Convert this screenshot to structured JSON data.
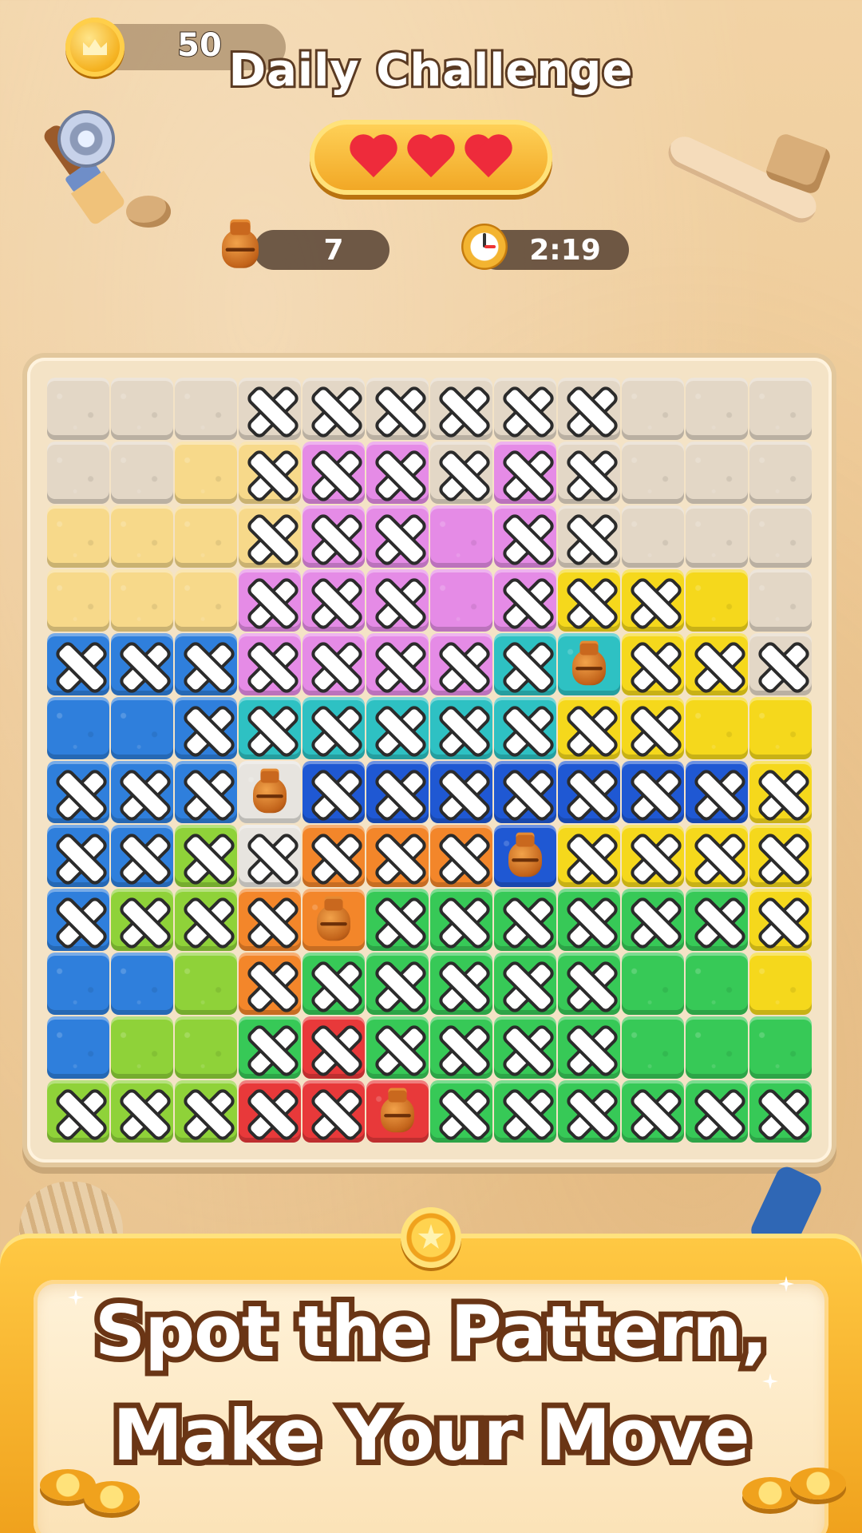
{
  "hud": {
    "coins": "50",
    "title": "Daily Challenge",
    "lives": 3,
    "jars_remaining": "7",
    "timer": "2:19"
  },
  "icons": {
    "coin": "crown-coin-icon",
    "settings": "gear-icon",
    "heart": "heart-icon",
    "jar": "jar-icon",
    "timer": "stopwatch-icon"
  },
  "colors": {
    "S": "#e3d7c6",
    "Y": "#f7d98a",
    "M": "#e58be6",
    "U": "#2f7fdc",
    "T": "#2ec1c3",
    "N": "#1f58d3",
    "G": "#f5d81c",
    "O": "#f3862a",
    "L": "#37c957",
    "K": "#8fd239",
    "R": "#e8393a",
    "W": "#e7e4df"
  },
  "board": {
    "rows": [
      [
        "S",
        "S",
        "S",
        "S",
        "S",
        "S",
        "S",
        "S",
        "S",
        "S",
        "S",
        "S"
      ],
      [
        "S",
        "S",
        "Y",
        "Y",
        "M",
        "M",
        "S",
        "M",
        "S",
        "S",
        "S",
        "S"
      ],
      [
        "Y",
        "Y",
        "Y",
        "Y",
        "M",
        "M",
        "M",
        "M",
        "S",
        "S",
        "S",
        "S"
      ],
      [
        "Y",
        "Y",
        "Y",
        "M",
        "M",
        "M",
        "M",
        "M",
        "G",
        "G",
        "G",
        "S"
      ],
      [
        "U",
        "U",
        "U",
        "M",
        "M",
        "M",
        "M",
        "T",
        "T",
        "G",
        "G",
        "S"
      ],
      [
        "U",
        "U",
        "U",
        "T",
        "T",
        "T",
        "T",
        "T",
        "G",
        "G",
        "G",
        "G"
      ],
      [
        "U",
        "U",
        "U",
        "W",
        "N",
        "N",
        "N",
        "N",
        "N",
        "N",
        "N",
        "G"
      ],
      [
        "U",
        "U",
        "K",
        "W",
        "O",
        "O",
        "O",
        "N",
        "G",
        "G",
        "G",
        "G"
      ],
      [
        "U",
        "K",
        "K",
        "O",
        "O",
        "L",
        "L",
        "L",
        "L",
        "L",
        "L",
        "G"
      ],
      [
        "U",
        "U",
        "K",
        "O",
        "L",
        "L",
        "L",
        "L",
        "L",
        "L",
        "L",
        "G"
      ],
      [
        "U",
        "K",
        "K",
        "L",
        "R",
        "L",
        "L",
        "L",
        "L",
        "L",
        "L",
        "L"
      ],
      [
        "K",
        "K",
        "K",
        "R",
        "R",
        "R",
        "L",
        "L",
        "L",
        "L",
        "L",
        "L"
      ]
    ],
    "marks": [
      [
        "",
        "",
        "",
        "x",
        "x",
        "x",
        "x",
        "x",
        "x",
        "",
        "",
        ""
      ],
      [
        "",
        "",
        "",
        "x",
        "x",
        "x",
        "x",
        "x",
        "x",
        "",
        "",
        ""
      ],
      [
        "",
        "",
        "",
        "x",
        "x",
        "x",
        "",
        "x",
        "x",
        "",
        "",
        ""
      ],
      [
        "",
        "",
        "",
        "x",
        "x",
        "x",
        "",
        "x",
        "x",
        "x",
        "",
        ""
      ],
      [
        "x",
        "x",
        "x",
        "x",
        "x",
        "x",
        "x",
        "x",
        "j",
        "x",
        "x",
        "x"
      ],
      [
        "",
        "",
        "x",
        "x",
        "x",
        "x",
        "x",
        "x",
        "x",
        "x",
        "",
        ""
      ],
      [
        "x",
        "x",
        "x",
        "j",
        "x",
        "x",
        "x",
        "x",
        "x",
        "x",
        "x",
        "x"
      ],
      [
        "x",
        "x",
        "x",
        "x",
        "x",
        "x",
        "x",
        "j",
        "x",
        "x",
        "x",
        "x"
      ],
      [
        "x",
        "x",
        "x",
        "x",
        "j",
        "x",
        "x",
        "x",
        "x",
        "x",
        "x",
        "x"
      ],
      [
        "",
        "",
        "",
        "x",
        "x",
        "x",
        "x",
        "x",
        "x",
        "",
        "",
        ""
      ],
      [
        "",
        "",
        "",
        "x",
        "x",
        "x",
        "x",
        "x",
        "x",
        "",
        "",
        ""
      ],
      [
        "x",
        "x",
        "x",
        "x",
        "x",
        "j",
        "x",
        "x",
        "x",
        "x",
        "x",
        "x"
      ]
    ]
  },
  "banner": {
    "line1": "Spot the Pattern,",
    "line2": "Make Your Move"
  }
}
